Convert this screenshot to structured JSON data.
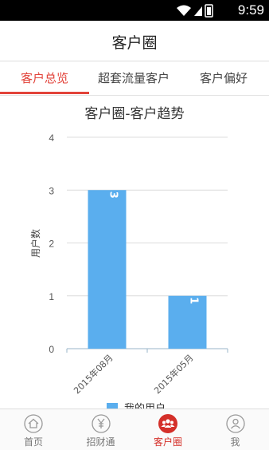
{
  "status_bar": {
    "time": "9:59"
  },
  "header": {
    "title": "客户圈"
  },
  "tabs": [
    {
      "label": "客户总览",
      "active": true
    },
    {
      "label": "超套流量客户",
      "active": false
    },
    {
      "label": "客户偏好",
      "active": false
    }
  ],
  "chart_title": "客户圈-客户趋势",
  "chart_data": {
    "type": "bar",
    "title": "客户圈-客户趋势",
    "categories": [
      "2015年08月",
      "2015年05月"
    ],
    "values": [
      3,
      1
    ],
    "data_labels": [
      "3",
      "1"
    ],
    "ylabel": "用户数",
    "ylim": [
      0,
      4
    ],
    "yticks": [
      "0",
      "1",
      "2",
      "3",
      "4"
    ],
    "grid": true,
    "legend": {
      "entries": [
        "我的用户"
      ],
      "placement": "bottom"
    },
    "colors": {
      "bar": "#5aaeee"
    }
  },
  "bottom_nav": [
    {
      "label": "首页",
      "icon": "home-icon",
      "active": false
    },
    {
      "label": "招财通",
      "icon": "yen-icon",
      "active": false
    },
    {
      "label": "客户圈",
      "icon": "people-icon",
      "active": true
    },
    {
      "label": "我",
      "icon": "person-icon",
      "active": false
    }
  ],
  "colors": {
    "accent": "#e2433a",
    "bar": "#5aaeee",
    "nav_active": "#d4302a"
  }
}
